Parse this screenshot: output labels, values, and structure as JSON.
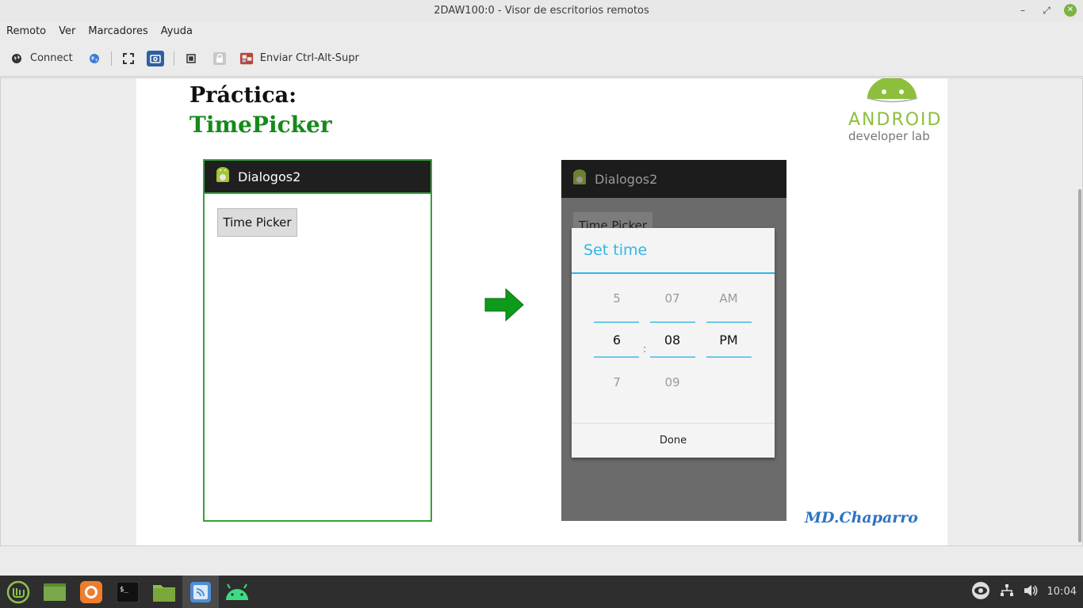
{
  "window": {
    "title": "2DAW100:0 - Visor de escritorios remotos",
    "controls": {
      "minimize": "–",
      "maximize": "⤢",
      "close": "✕"
    }
  },
  "menu": [
    "Remoto",
    "Ver",
    "Marcadores",
    "Ayuda"
  ],
  "toolbar": {
    "connect_label": "Connect",
    "send_cad_label": "Enviar Ctrl-Alt-Supr"
  },
  "slide": {
    "title_line1": "Práctica:",
    "title_line2": "TimePicker",
    "logo_word": "ANDROID",
    "logo_sub": "developer lab",
    "author": "MD.Chaparro",
    "phone_left": {
      "app_title": "Dialogos2",
      "button_label": "Time Picker"
    },
    "phone_right": {
      "app_title": "Dialogos2",
      "button_label": "Time Picker",
      "dialog": {
        "title": "Set time",
        "hours": {
          "prev": "5",
          "current": "6",
          "next": "7"
        },
        "minutes": {
          "prev": "07",
          "current": "08",
          "next": "09"
        },
        "ampm": {
          "prev": "AM",
          "current": "PM"
        },
        "separator": ":",
        "done_label": "Done"
      }
    }
  },
  "colors": {
    "accent_green": "#168a1a",
    "holo_blue": "#33b5e5",
    "author_blue": "#2e73c4"
  },
  "taskbar": {
    "apps": [
      "mint-menu-icon",
      "show-desktop-icon",
      "firefox-icon",
      "terminal-icon",
      "files-icon",
      "remote-viewer-icon",
      "android-studio-icon"
    ],
    "clock": "10:04"
  }
}
